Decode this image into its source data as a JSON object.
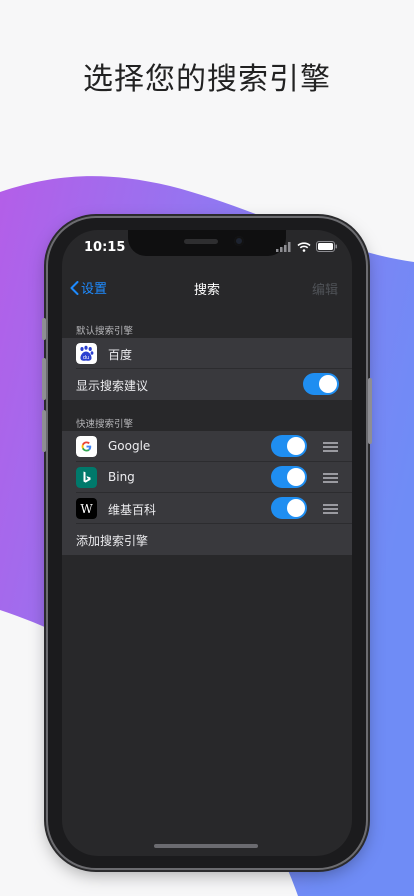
{
  "headline": "选择您的搜索引擎",
  "status_bar": {
    "time": "10:15"
  },
  "nav": {
    "back_label": "设置",
    "title": "搜索",
    "edit_label": "编辑"
  },
  "default_section": {
    "header": "默认搜索引擎",
    "engine": {
      "name": "百度",
      "icon": "baidu-icon"
    },
    "suggest": {
      "label": "显示搜索建议",
      "enabled": true
    }
  },
  "quick_section": {
    "header": "快速搜索引擎",
    "engines": [
      {
        "name": "Google",
        "icon": "google-icon",
        "enabled": true
      },
      {
        "name": "Bing",
        "icon": "bing-icon",
        "enabled": true
      },
      {
        "name": "维基百科",
        "icon": "wikipedia-icon",
        "enabled": true
      }
    ],
    "add_label": "添加搜索引擎"
  },
  "colors": {
    "accent": "#1f8ef1",
    "gradient_start": "#b45ee8",
    "gradient_end": "#6f8cf6"
  }
}
